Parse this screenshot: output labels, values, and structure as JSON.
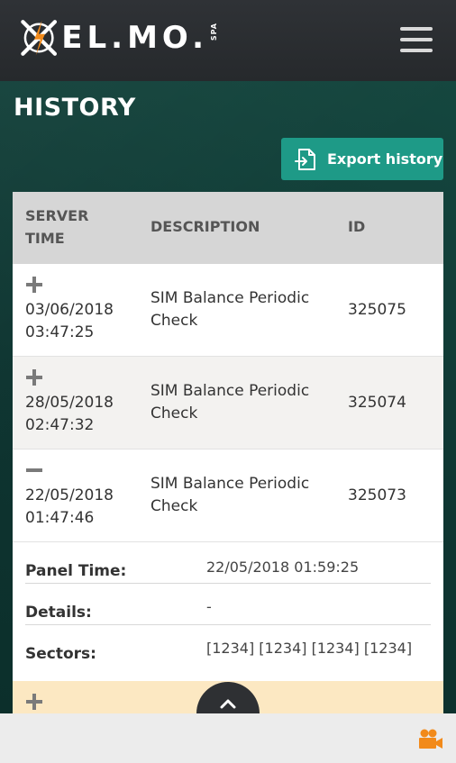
{
  "header": {
    "logo_text": "EL.MO.",
    "logo_suffix": "SPA",
    "menu_icon": "hamburger-icon"
  },
  "page": {
    "title": "HISTORY",
    "export_label": "Export history",
    "export_icon": "export-file-icon"
  },
  "table": {
    "headers": {
      "time": "SERVER TIME",
      "description": "DESCRIPTION",
      "id": "ID"
    },
    "rows": [
      {
        "expanded": false,
        "date": "03/06/2018",
        "time": "03:47:25",
        "description": "SIM Balance Periodic Check",
        "id": "325075"
      },
      {
        "expanded": false,
        "date": "28/05/2018",
        "time": "02:47:32",
        "description": "SIM Balance Periodic Check",
        "id": "325074"
      },
      {
        "expanded": true,
        "date": "22/05/2018",
        "time": "01:47:46",
        "description": "SIM Balance Periodic Check",
        "id": "325073"
      }
    ],
    "detail": {
      "panel_time_label": "Panel Time:",
      "panel_time_value": "22/05/2018 01:59:25",
      "details_label": "Details:",
      "details_value": "-",
      "sectors_label": "Sectors:",
      "sectors_value": "[1234] [1234] [1234] [1234]"
    }
  },
  "colors": {
    "header_bg": "#2b2e31",
    "accent_teal": "#1e9a87",
    "highlight_row": "#fce8c2",
    "camera_orange": "#f28a1a"
  },
  "footer": {
    "camera_icon": "video-camera-icon"
  }
}
